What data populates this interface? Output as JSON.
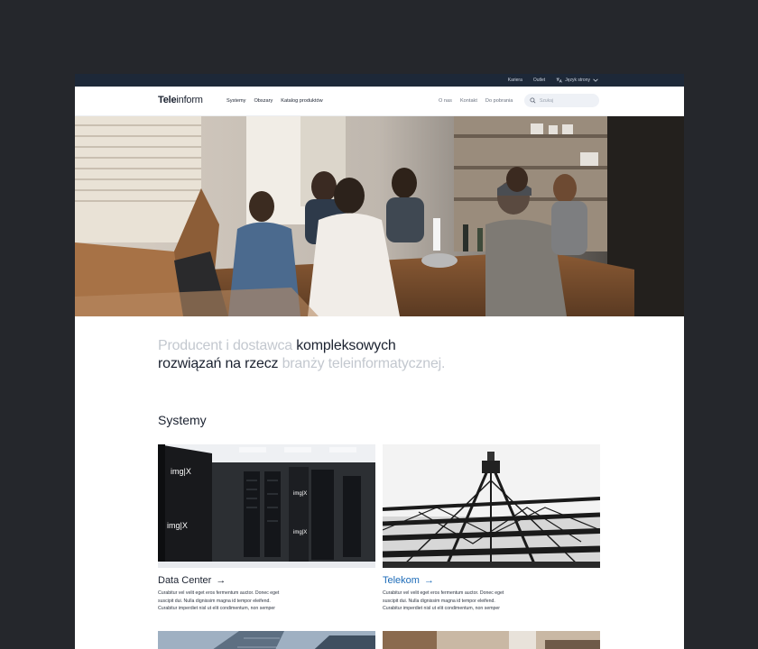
{
  "topbar": {
    "links": [
      "Kariera",
      "Outlet"
    ],
    "language_label": "Język strony"
  },
  "header": {
    "logo_bold": "Tele",
    "logo_thin": "inform",
    "nav_left": [
      "Systemy",
      "Obszary",
      "Katalog produktów"
    ],
    "nav_right": [
      "O nas",
      "Kontakt",
      "Do pobrania"
    ],
    "search_placeholder": "Szukaj"
  },
  "tagline": {
    "part1": "Producent i dostawca ",
    "part2": "kompleksowych",
    "part3": "rozwiązań na rzecz ",
    "part4": "branży teleinformatycznej."
  },
  "systems": {
    "title": "Systemy",
    "cards": [
      {
        "title": "Data Center",
        "arrow": "→",
        "desc": [
          "Curabitur vel velit eget eros fermentum auctor. Donec eget",
          "suscipit dui. Nulla dignissim magna id tempor eleifend.",
          "Curabitur imperdiet nisl ut elit condimentum, non semper"
        ],
        "rack_label": "img|X"
      },
      {
        "title": "Telekom",
        "arrow": "→",
        "desc": [
          "Curabitur vel velit eget eros fermentum auctor. Donec eget",
          "suscipit dui. Nulla dignissim magna id tempor eleifend.",
          "Curabitur imperdiet nisl ut elit condimentum, non semper"
        ]
      }
    ]
  },
  "colors": {
    "background": "#25272c",
    "topbar": "#1d2838",
    "text_dark": "#1b2230",
    "text_muted": "#c3c8cf",
    "link_blue": "#1c6bb8"
  }
}
